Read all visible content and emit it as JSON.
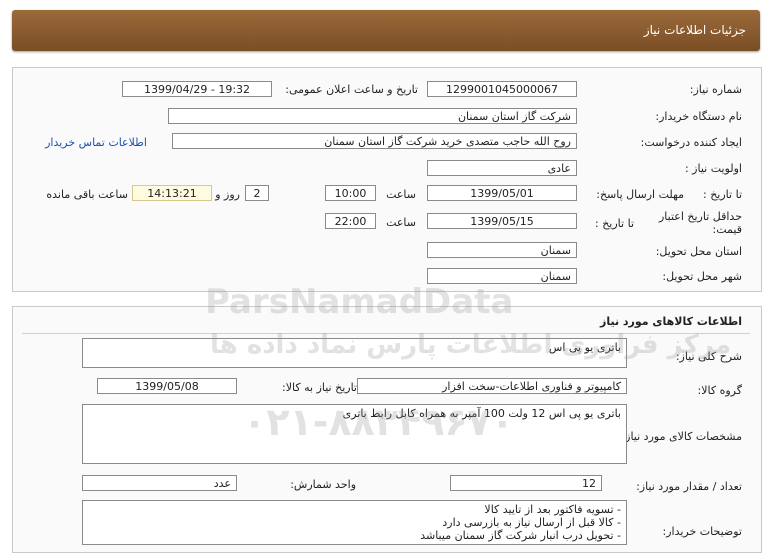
{
  "header": {
    "title": "جزئیات اطلاعات نیاز"
  },
  "need": {
    "need_number_label": "شماره نیاز:",
    "need_number": "1299001045000067",
    "announce_label": "تاریخ و ساعت اعلان عمومی:",
    "announce_value": "1399/04/29 - 19:32",
    "buyer_label": "نام دستگاه خریدار:",
    "buyer_value": "شرکت گاز استان سمنان",
    "creator_label": "ایجاد کننده درخواست:",
    "creator_value": "روح الله  حاجب متصدی خرید شرکت گاز استان سمنان",
    "contact_link": "اطلاعات تماس خریدار",
    "priority_label": "اولویت نیاز :",
    "priority_value": "عادی",
    "deadline_label": "مهلت ارسال پاسخ:",
    "to_date_label": "تا تاریخ :",
    "deadline_date": "1399/05/01",
    "time_label": "ساعت",
    "deadline_time": "10:00",
    "days_value": "2",
    "days_label": "روز و",
    "remaining_time": "14:13:21",
    "remaining_label": "ساعت باقی مانده",
    "validity_label": "حداقل تاریخ اعتبار قیمت:",
    "validity_date": "1399/05/15",
    "validity_time": "22:00",
    "province_label": "استان محل تحویل:",
    "province_value": "سمنان",
    "city_label": "شهر محل تحویل:",
    "city_value": "سمنان"
  },
  "goods": {
    "section_title": "اطلاعات کالاهای مورد نیاز",
    "summary_label": "شرح کلی نیاز:",
    "summary_value": "باتری یو پی اس",
    "group_label": "گروه کالا:",
    "group_value": "کامپیوتر و فناوری اطلاعات-سخت افزار",
    "need_date_label": "تاریخ نیاز به کالا:",
    "need_date_value": "1399/05/08",
    "spec_label": "مشخصات کالای مورد نیاز:",
    "spec_value": "باتری یو پی اس 12 ولت 100 آمپر به همراه کابل رابط باتری",
    "qty_label": "تعداد / مقدار مورد نیاز:",
    "qty_value": "12",
    "unit_label": "واحد شمارش:",
    "unit_value": "عدد",
    "notes_label": "توضیحات خریدار:",
    "notes_lines": [
      "- تسویه فاکتور بعد از تایید کالا",
      "- کالا قبل از ارسال نیاز به بازرسی دارد",
      "- تحویل درب انبار شرکت گاز سمنان میباشد"
    ]
  },
  "watermark": {
    "brand": "ParsNamadData",
    "slogan": "مرکز فراوری اطلاعات پارس نماد داده ها",
    "phone": "۰۲۱-۸۸۳۴۹۶۷۰"
  }
}
